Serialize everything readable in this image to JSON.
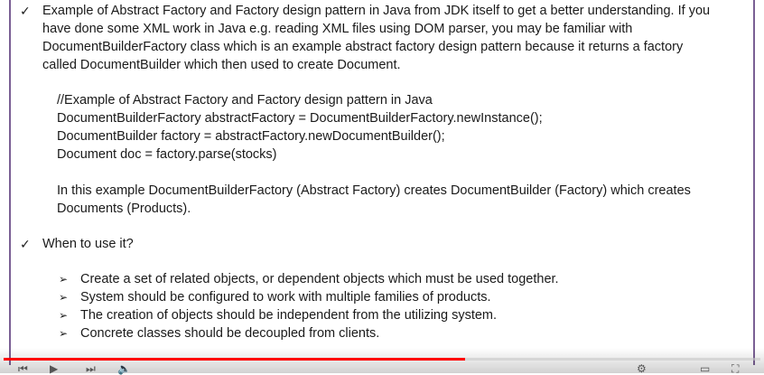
{
  "slide": {
    "bullet1": {
      "marker": "✓",
      "lines": [
        "Example of Abstract Factory and Factory design pattern in Java from JDK itself to get a better understanding. If you",
        "have done some XML work in Java e.g. reading XML files using DOM parser, you may be familiar with",
        "DocumentBuilderFactory  class which is an example abstract factory design pattern because it returns a factory",
        "called DocumentBuilder which then used to create Document."
      ]
    },
    "code": [
      "//Example of Abstract Factory and Factory design pattern  in Java",
      "DocumentBuilderFactory abstractFactory = DocumentBuilderFactory.newInstance();",
      "DocumentBuilder factory = abstractFactory.newDocumentBuilder();",
      "Document doc = factory.parse(stocks)"
    ],
    "explanation": [
      "In this example DocumentBuilderFactory (Abstract Factory) creates DocumentBuilder (Factory) which creates",
      "Documents (Products)."
    ],
    "bullet2": {
      "marker": "✓",
      "text": "When to use it?"
    },
    "sub_marker": "➢",
    "sub_items": [
      "Create a set of related objects, or dependent objects which must be used together.",
      "System should be configured to work with multiple families of products.",
      "The creation of objects should be independent from the utilizing system.",
      "Concrete classes should be decoupled from clients."
    ]
  },
  "player": {
    "progress": 0.61,
    "colors": {
      "played": "#ff0000",
      "border": "#7a5f94"
    }
  }
}
